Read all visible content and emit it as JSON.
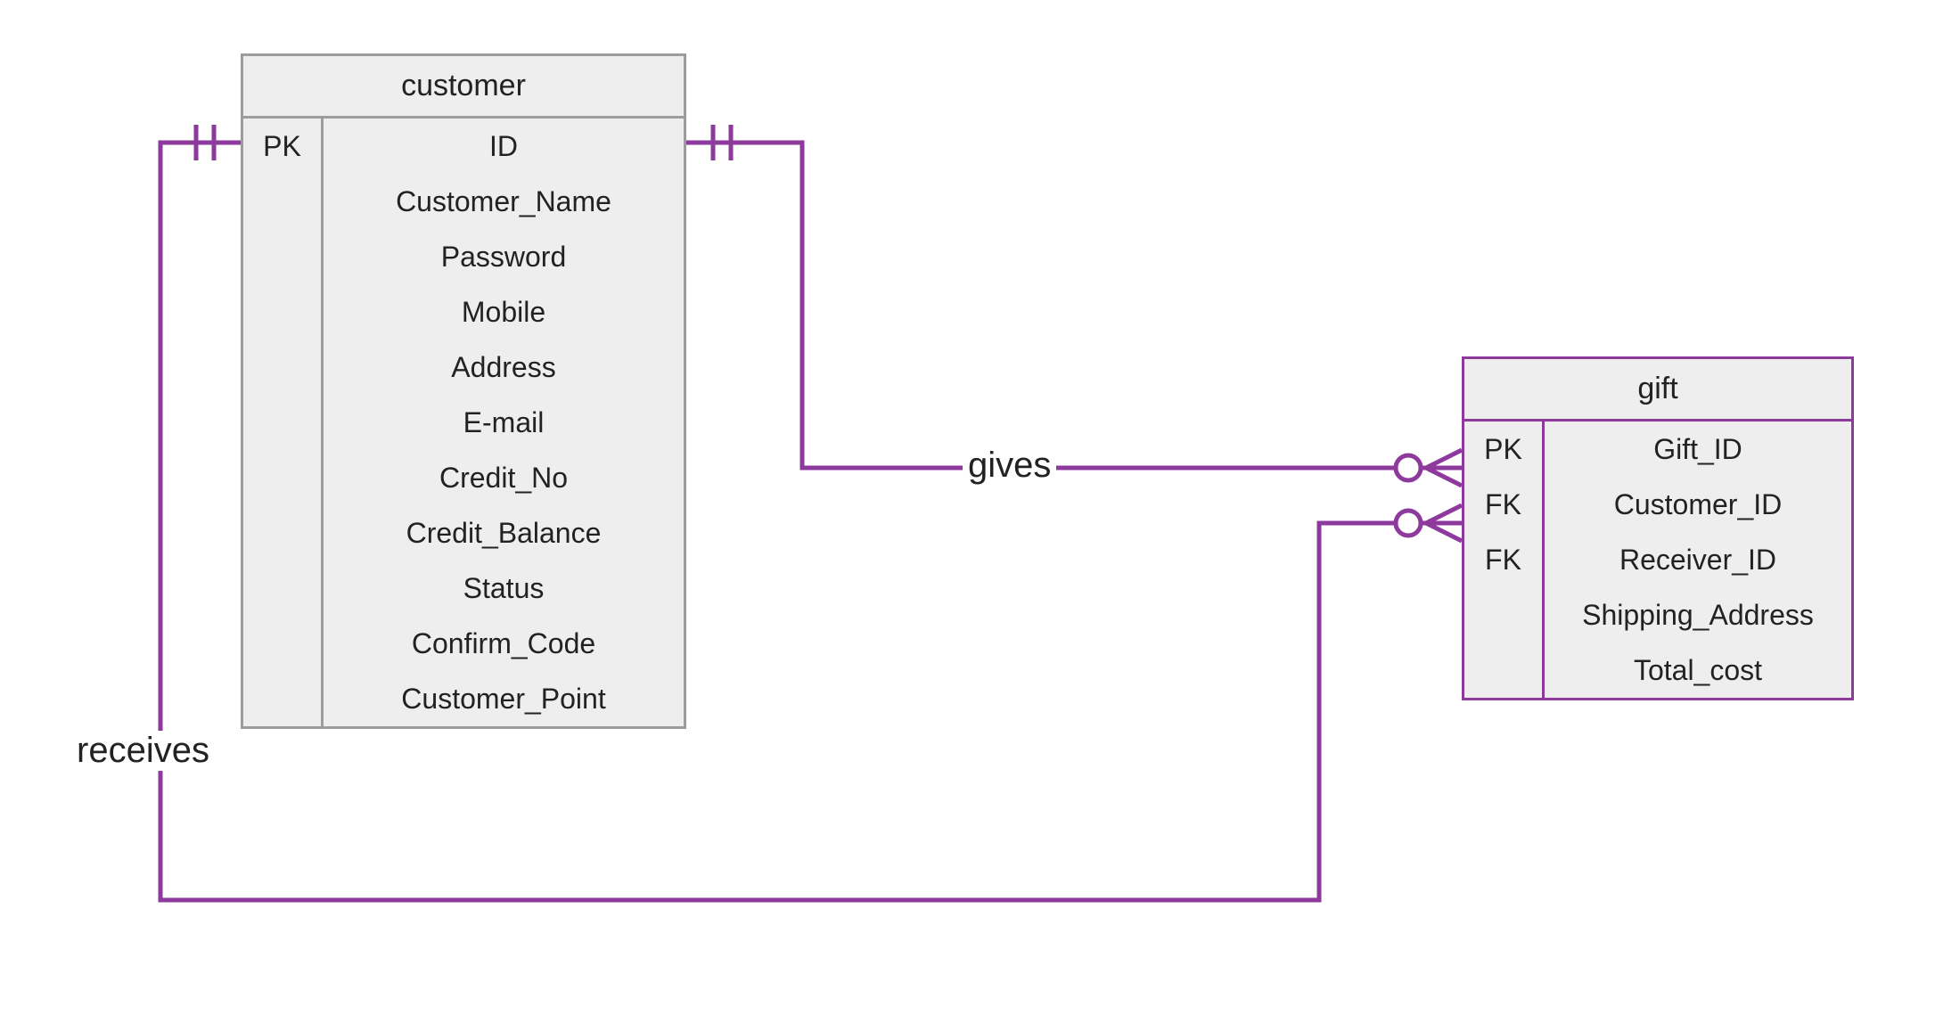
{
  "entities": {
    "customer": {
      "title": "customer",
      "rows": [
        {
          "key": "PK",
          "attr": "ID"
        },
        {
          "key": "",
          "attr": "Customer_Name"
        },
        {
          "key": "",
          "attr": "Password"
        },
        {
          "key": "",
          "attr": "Mobile"
        },
        {
          "key": "",
          "attr": "Address"
        },
        {
          "key": "",
          "attr": "E-mail"
        },
        {
          "key": "",
          "attr": "Credit_No"
        },
        {
          "key": "",
          "attr": "Credit_Balance"
        },
        {
          "key": "",
          "attr": "Status"
        },
        {
          "key": "",
          "attr": "Confirm_Code"
        },
        {
          "key": "",
          "attr": "Customer_Point"
        }
      ]
    },
    "gift": {
      "title": "gift",
      "rows": [
        {
          "key": "PK",
          "attr": "Gift_ID"
        },
        {
          "key": "FK",
          "attr": "Customer_ID"
        },
        {
          "key": "FK",
          "attr": "Receiver_ID"
        },
        {
          "key": "",
          "attr": "Shipping_Address"
        },
        {
          "key": "",
          "attr": "Total_cost"
        }
      ]
    }
  },
  "relationships": {
    "gives": {
      "label": "gives",
      "from_entity": "customer",
      "to_entity": "gift",
      "from_cardinality": "one-and-only-one",
      "to_cardinality": "zero-or-many"
    },
    "receives": {
      "label": "receives",
      "from_entity": "customer",
      "to_entity": "gift",
      "from_cardinality": "one-and-only-one",
      "to_cardinality": "zero-or-many"
    }
  },
  "colors": {
    "connector": "#8e3a9d",
    "entity_bg": "#eeeeee",
    "customer_border": "#9c9c9c",
    "gift_border": "#8e3a9d"
  }
}
